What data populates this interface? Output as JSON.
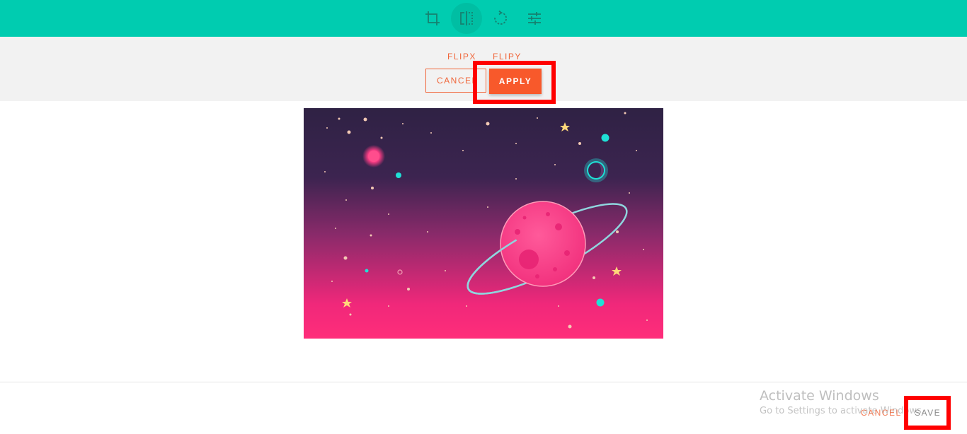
{
  "toolbar": {
    "tools": [
      {
        "name": "crop-icon",
        "active": false
      },
      {
        "name": "flip-icon",
        "active": true
      },
      {
        "name": "rotate-icon",
        "active": false
      },
      {
        "name": "adjust-icon",
        "active": false
      }
    ]
  },
  "flip_panel": {
    "flipx_label": "FLIPX",
    "flipy_label": "FLIPY",
    "cancel_label": "CANCEL",
    "apply_label": "APPLY"
  },
  "footer": {
    "cancel_label": "CANCEL",
    "save_label": "SAVE"
  },
  "watermark": {
    "title": "Activate Windows",
    "subtitle": "Go to Settings to activate Windows."
  },
  "colors": {
    "toolbar_bg": "#00ccb0",
    "accent": "#f8592b",
    "highlight": "#ff0000"
  }
}
